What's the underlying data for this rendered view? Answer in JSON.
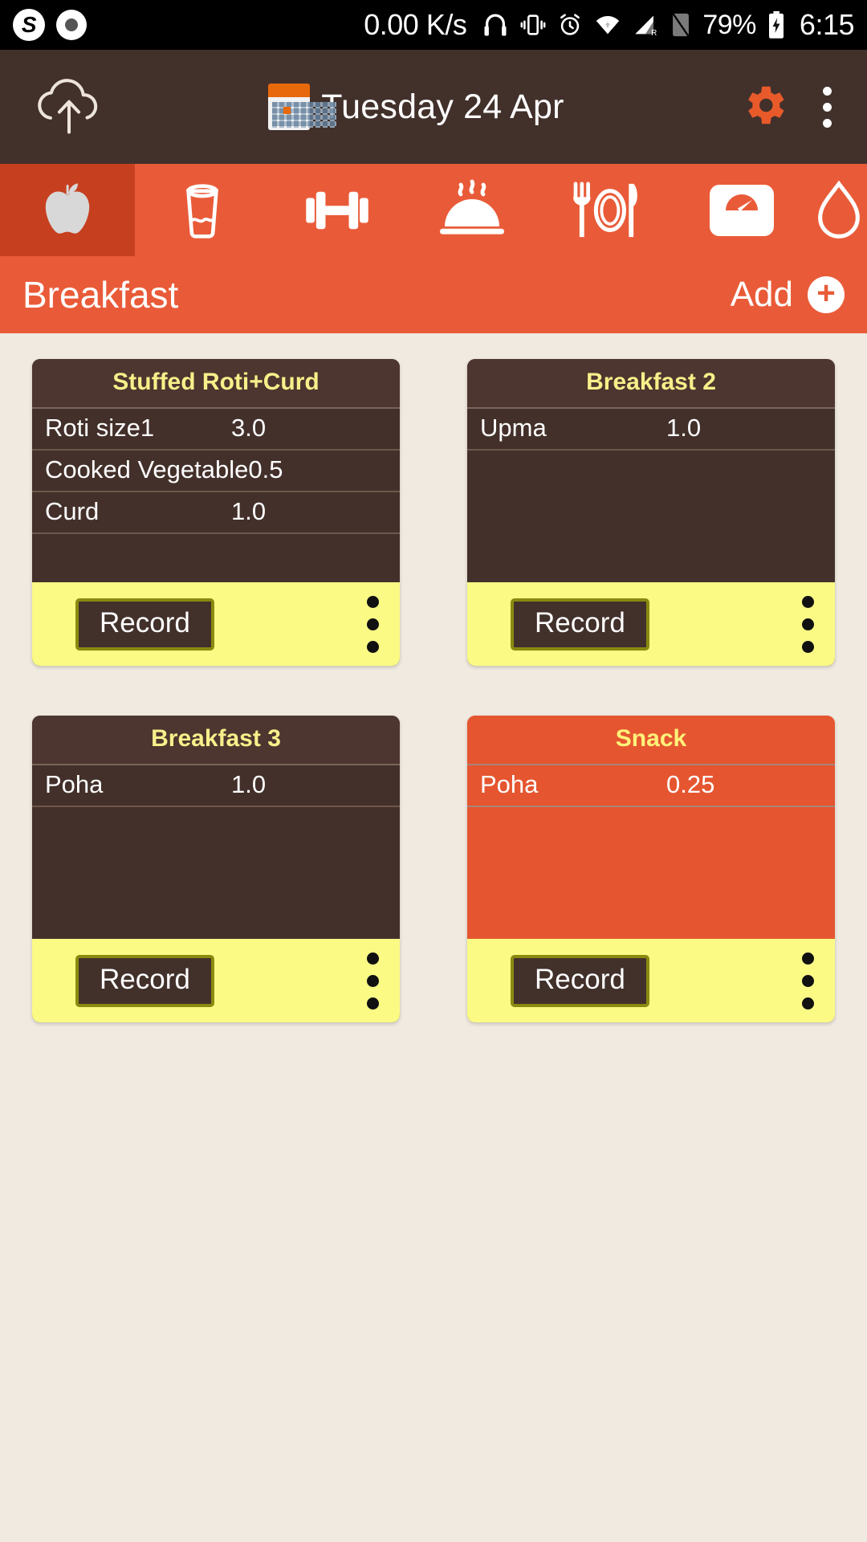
{
  "statusbar": {
    "icons_left": [
      "skype-icon",
      "screen-record-icon"
    ],
    "network_rate": "0.00 K/s",
    "icons_right": [
      "headset-icon",
      "vibrate-icon",
      "alarm-icon",
      "wifi-icon",
      "signal-roaming-icon",
      "sim-empty-icon"
    ],
    "battery_percent": "79%",
    "battery_state": "charging",
    "time": "6:15"
  },
  "appbar": {
    "upload_icon": "cloud-upload-icon",
    "calendar_icon": "calendar-icon",
    "date": "Tuesday 24 Apr",
    "settings_icon": "gear-icon",
    "overflow_icon": "overflow-menu-icon"
  },
  "tabs": [
    {
      "name": "fruit",
      "icon": "apple-icon",
      "active": true
    },
    {
      "name": "drink",
      "icon": "glass-of-water-icon",
      "active": false
    },
    {
      "name": "exercise",
      "icon": "dumbbell-icon",
      "active": false
    },
    {
      "name": "hot-meal",
      "icon": "covered-dish-icon",
      "active": false
    },
    {
      "name": "meal",
      "icon": "fork-plate-knife-icon",
      "active": false
    },
    {
      "name": "weight",
      "icon": "weighing-scale-icon",
      "active": false
    },
    {
      "name": "water",
      "icon": "water-drop-icon",
      "active": false
    }
  ],
  "section": {
    "title": "Breakfast",
    "add_label": "Add",
    "add_icon": "plus-circle-icon"
  },
  "cards": [
    {
      "title": "Stuffed Roti+Curd",
      "theme": "dark",
      "items": [
        {
          "name": "Roti size1",
          "qty": "3.0"
        },
        {
          "name": "Cooked Vegetable",
          "qty": "0.5"
        },
        {
          "name": "Curd",
          "qty": "1.0"
        }
      ],
      "record_label": "Record",
      "overflow_icon": "overflow-menu-icon"
    },
    {
      "title": "Breakfast 2",
      "theme": "dark",
      "items": [
        {
          "name": "Upma",
          "qty": "1.0"
        }
      ],
      "record_label": "Record",
      "overflow_icon": "overflow-menu-icon"
    },
    {
      "title": "Breakfast 3",
      "theme": "dark",
      "items": [
        {
          "name": "Poha",
          "qty": "1.0"
        }
      ],
      "record_label": "Record",
      "overflow_icon": "overflow-menu-icon"
    },
    {
      "title": "Snack",
      "theme": "orange",
      "items": [
        {
          "name": "Poha",
          "qty": "0.25"
        }
      ],
      "record_label": "Record",
      "overflow_icon": "overflow-menu-icon"
    }
  ],
  "colors": {
    "page_background": "#F0EAE0",
    "appbar": "#42302B",
    "accent_orange": "#E95B38",
    "accent_orange_dark": "#C6401F",
    "card_dark": "#43302A",
    "card_orange": "#E55630",
    "card_title_yellow": "#F7F08A",
    "footer_yellow": "#FAFA85",
    "record_border": "#8A8A10"
  }
}
